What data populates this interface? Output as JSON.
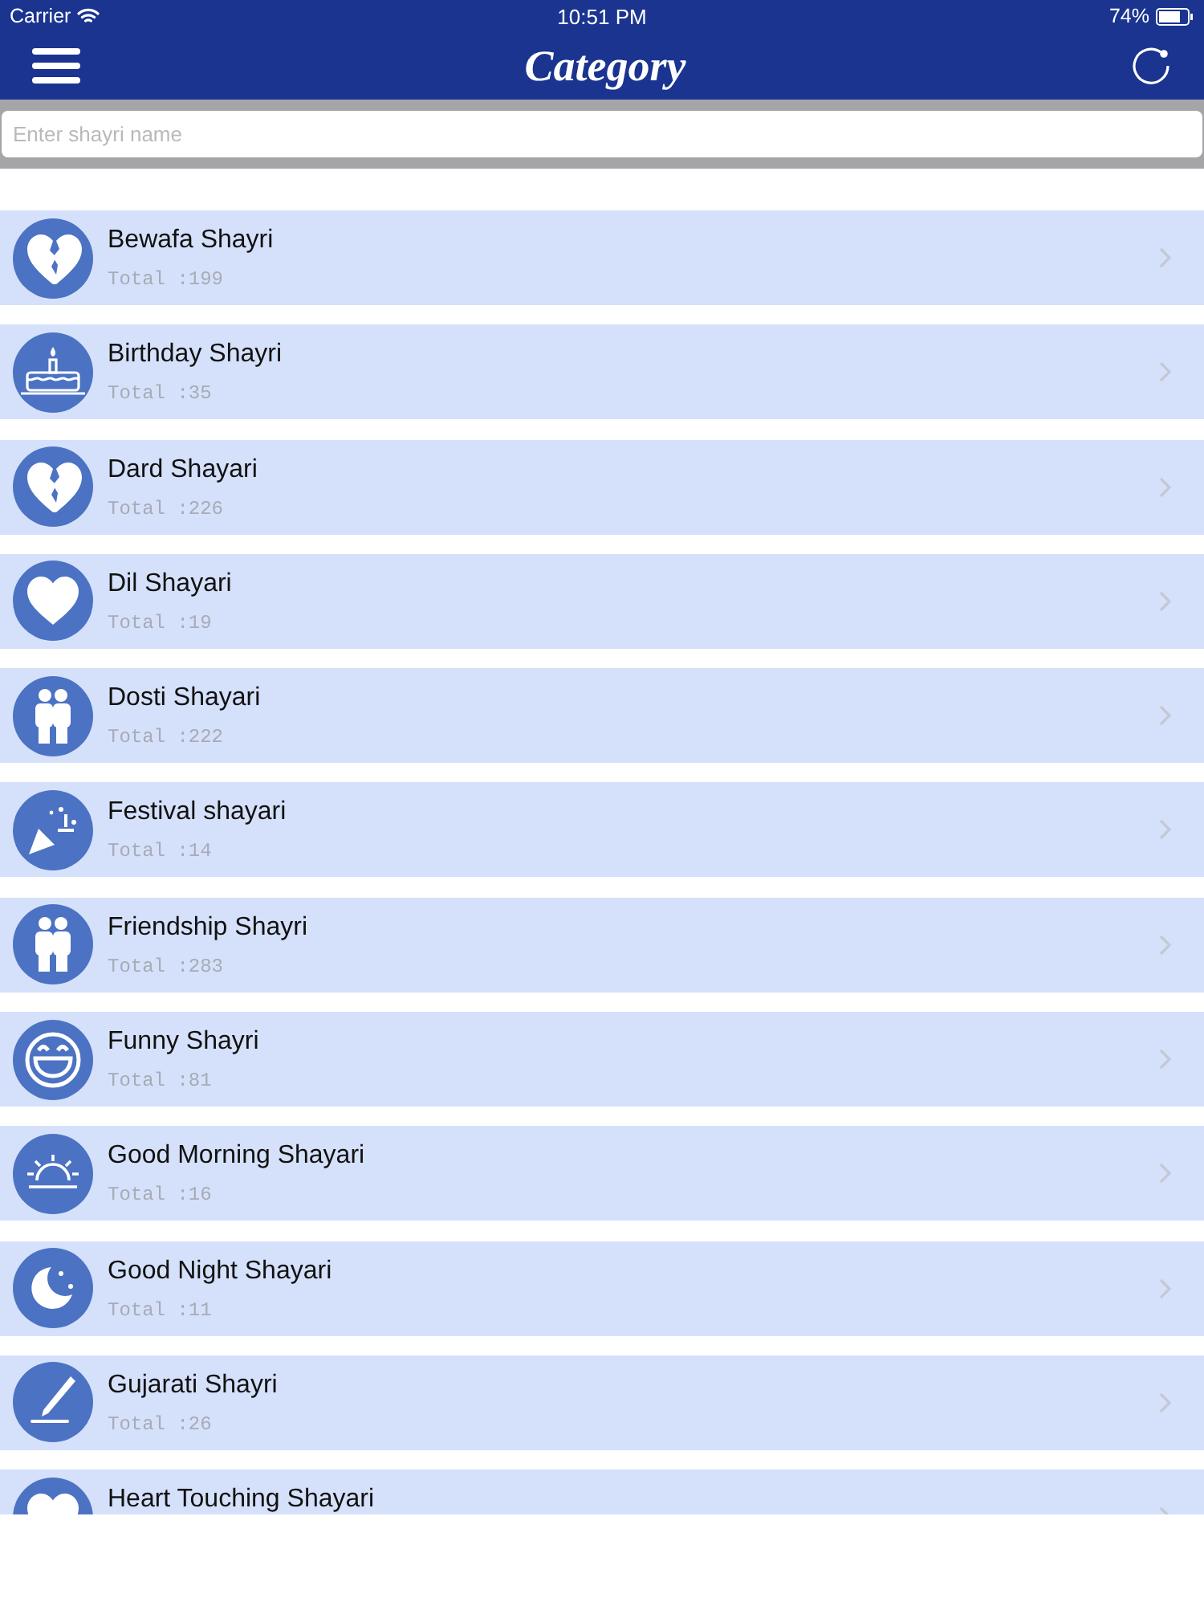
{
  "status_bar": {
    "carrier": "Carrier",
    "time": "10:51 PM",
    "battery": "74%"
  },
  "nav": {
    "title": "Category"
  },
  "search": {
    "placeholder": "Enter shayri name"
  },
  "categories": [
    {
      "title": "Bewafa Shayri",
      "total": "Total :199",
      "kind": "brokenheart"
    },
    {
      "title": "Birthday Shayri",
      "total": "Total :35",
      "kind": "cake"
    },
    {
      "title": "Dard Shayari",
      "total": "Total :226",
      "kind": "brokenheart"
    },
    {
      "title": "Dil Shayari",
      "total": "Total :19",
      "kind": "heart"
    },
    {
      "title": "Dosti Shayari",
      "total": "Total :222",
      "kind": "people"
    },
    {
      "title": "Festival shayari",
      "total": "Total :14",
      "kind": "party"
    },
    {
      "title": "Friendship Shayri",
      "total": "Total :283",
      "kind": "people"
    },
    {
      "title": "Funny Shayri",
      "total": "Total :81",
      "kind": "smile"
    },
    {
      "title": "Good Morning Shayari",
      "total": "Total :16",
      "kind": "sunrise"
    },
    {
      "title": "Good Night Shayari",
      "total": "Total :11",
      "kind": "moon"
    },
    {
      "title": "Gujarati Shayri",
      "total": "Total :26",
      "kind": "pen"
    },
    {
      "title": "Heart Touching Shayari",
      "kind": "heart"
    }
  ]
}
